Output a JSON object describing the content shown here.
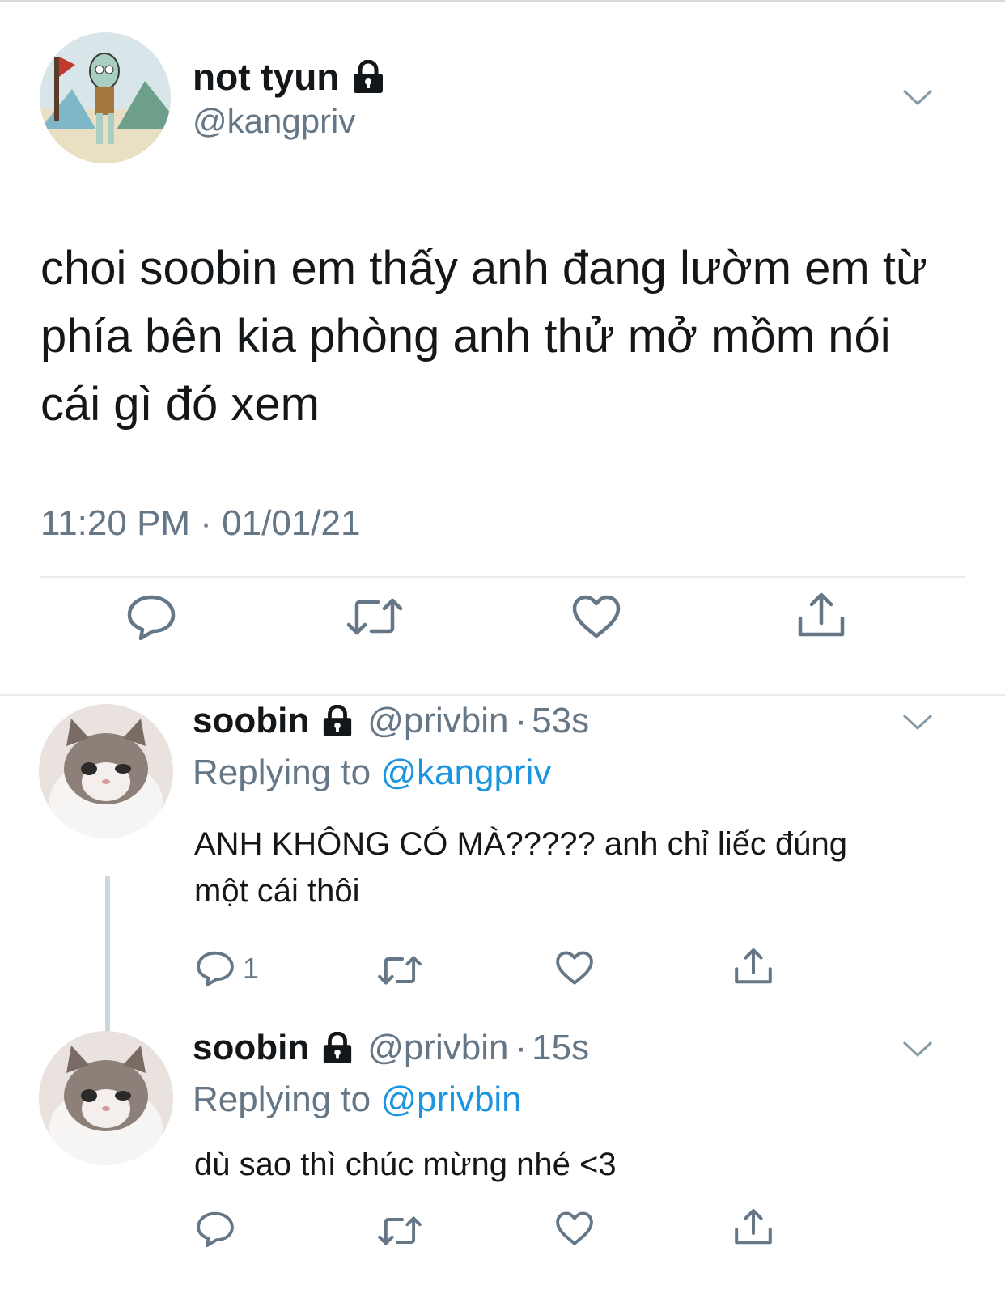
{
  "main_tweet": {
    "display_name": "not tyun",
    "handle": "@kangpriv",
    "text": "choi soobin em thấy anh đang lườm em từ phía bên kia phòng anh thử mở mồm nói cái gì đó xem",
    "timestamp": "11:20 PM · 01/01/21",
    "actions": [
      "reply-icon",
      "retweet-icon",
      "like-icon",
      "share-icon"
    ]
  },
  "replies": [
    {
      "display_name": "soobin",
      "handle": "@privbin",
      "separator": "·",
      "time": "53s",
      "replying_prefix": "Replying to",
      "replying_to": "@kangpriv",
      "text": "ANH KHÔNG CÓ MÀ????? anh chỉ liếc đúng một cái thôi",
      "reply_count": "1"
    },
    {
      "display_name": "soobin",
      "handle": "@privbin",
      "separator": "·",
      "time": "15s",
      "replying_prefix": "Replying to",
      "replying_to": "@privbin",
      "text": "dù sao thì chúc mừng nhé <3",
      "reply_count": ""
    }
  ],
  "colors": {
    "text": "#14171a",
    "secondary": "#657786",
    "mention": "#1b95e0",
    "divider": "#e6ecf0"
  }
}
